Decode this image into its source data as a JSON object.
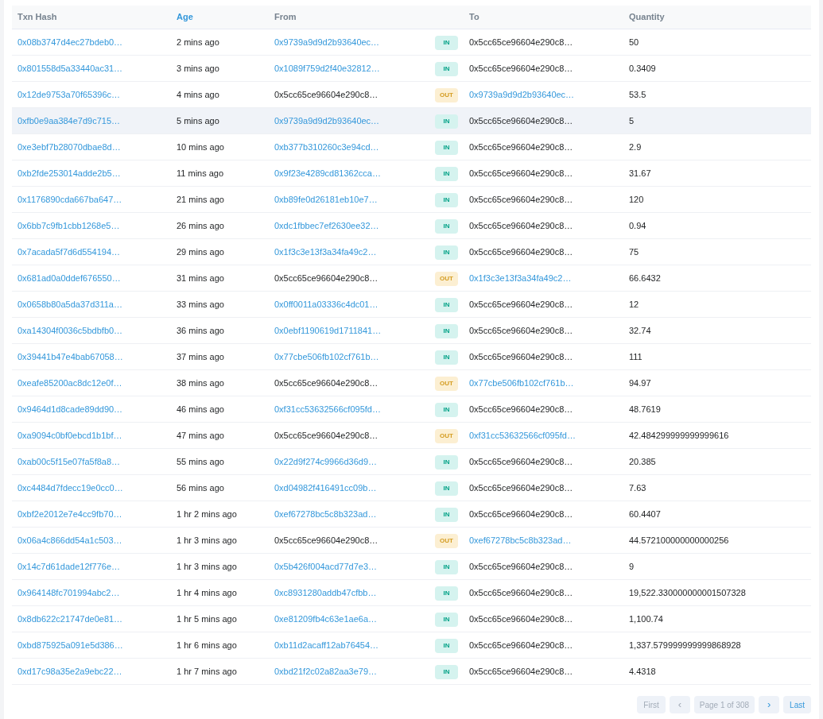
{
  "table": {
    "columns": [
      {
        "label": "Txn Hash",
        "selected": false
      },
      {
        "label": "Age",
        "selected": true
      },
      {
        "label": "From",
        "selected": false
      },
      {
        "label": "To",
        "selected": false
      },
      {
        "label": "Quantity",
        "selected": false
      }
    ],
    "rows": [
      {
        "hash": "0x08b3747d4ec27bdeb0…",
        "age": "2 mins ago",
        "from": "0x9739a9d9d2b93640ec…",
        "badge": "IN",
        "kind": "in",
        "to": "0x5cc65ce96604e290c8…",
        "quantity": "50",
        "highlighted": false
      },
      {
        "hash": "0x801558d5a33440ac31…",
        "age": "3 mins ago",
        "from": "0x1089f759d2f40e32812…",
        "badge": "IN",
        "kind": "in",
        "to": "0x5cc65ce96604e290c8…",
        "quantity": "0.3409",
        "highlighted": false
      },
      {
        "hash": "0x12de9753a70f65396c…",
        "age": "4 mins ago",
        "from": "0x5cc65ce96604e290c8…",
        "badge": "OUT",
        "kind": "out",
        "to": "0x9739a9d9d2b93640ec…",
        "quantity": "53.5",
        "highlighted": false
      },
      {
        "hash": "0xfb0e9aa384e7d9c715…",
        "age": "5 mins ago",
        "from": "0x9739a9d9d2b93640ec…",
        "badge": "IN",
        "kind": "in",
        "to": "0x5cc65ce96604e290c8…",
        "quantity": "5",
        "highlighted": true
      },
      {
        "hash": "0xe3ebf7b28070dbae8d…",
        "age": "10 mins ago",
        "from": "0xb377b310260c3e94cd…",
        "badge": "IN",
        "kind": "in",
        "to": "0x5cc65ce96604e290c8…",
        "quantity": "2.9",
        "highlighted": false
      },
      {
        "hash": "0xb2fde253014adde2b5…",
        "age": "11 mins ago",
        "from": "0x9f23e4289cd81362cca…",
        "badge": "IN",
        "kind": "in",
        "to": "0x5cc65ce96604e290c8…",
        "quantity": "31.67",
        "highlighted": false
      },
      {
        "hash": "0x1176890cda667ba647…",
        "age": "21 mins ago",
        "from": "0xb89fe0d26181eb10e7…",
        "badge": "IN",
        "kind": "in",
        "to": "0x5cc65ce96604e290c8…",
        "quantity": "120",
        "highlighted": false
      },
      {
        "hash": "0x6bb7c9fb1cbb1268e5…",
        "age": "26 mins ago",
        "from": "0xdc1fbbec7ef2630ee32…",
        "badge": "IN",
        "kind": "in",
        "to": "0x5cc65ce96604e290c8…",
        "quantity": "0.94",
        "highlighted": false
      },
      {
        "hash": "0x7acada5f7d6d554194…",
        "age": "29 mins ago",
        "from": "0x1f3c3e13f3a34fa49c2…",
        "badge": "IN",
        "kind": "in",
        "to": "0x5cc65ce96604e290c8…",
        "quantity": "75",
        "highlighted": false
      },
      {
        "hash": "0x681ad0a0ddef676550…",
        "age": "31 mins ago",
        "from": "0x5cc65ce96604e290c8…",
        "badge": "OUT",
        "kind": "out",
        "to": "0x1f3c3e13f3a34fa49c2…",
        "quantity": "66.6432",
        "highlighted": false
      },
      {
        "hash": "0x0658b80a5da37d311a…",
        "age": "33 mins ago",
        "from": "0x0ff0011a03336c4dc01…",
        "badge": "IN",
        "kind": "in",
        "to": "0x5cc65ce96604e290c8…",
        "quantity": "12",
        "highlighted": false
      },
      {
        "hash": "0xa14304f0036c5bdbfb0…",
        "age": "36 mins ago",
        "from": "0x0ebf1190619d1711841…",
        "badge": "IN",
        "kind": "in",
        "to": "0x5cc65ce96604e290c8…",
        "quantity": "32.74",
        "highlighted": false
      },
      {
        "hash": "0x39441b47e4bab67058…",
        "age": "37 mins ago",
        "from": "0x77cbe506fb102cf761b…",
        "badge": "IN",
        "kind": "in",
        "to": "0x5cc65ce96604e290c8…",
        "quantity": "111",
        "highlighted": false
      },
      {
        "hash": "0xeafe85200ac8dc12e0f…",
        "age": "38 mins ago",
        "from": "0x5cc65ce96604e290c8…",
        "badge": "OUT",
        "kind": "out",
        "to": "0x77cbe506fb102cf761b…",
        "quantity": "94.97",
        "highlighted": false
      },
      {
        "hash": "0x9464d1d8cade89dd90…",
        "age": "46 mins ago",
        "from": "0xf31cc53632566cf095fd…",
        "badge": "IN",
        "kind": "in",
        "to": "0x5cc65ce96604e290c8…",
        "quantity": "48.7619",
        "highlighted": false
      },
      {
        "hash": "0xa9094c0bf0ebcd1b1bf…",
        "age": "47 mins ago",
        "from": "0x5cc65ce96604e290c8…",
        "badge": "OUT",
        "kind": "out",
        "to": "0xf31cc53632566cf095fd…",
        "quantity": "42.484299999999999616",
        "highlighted": false
      },
      {
        "hash": "0xab00c5f15e07fa5f8a8…",
        "age": "55 mins ago",
        "from": "0x22d9f274c9966d36d9…",
        "badge": "IN",
        "kind": "in",
        "to": "0x5cc65ce96604e290c8…",
        "quantity": "20.385",
        "highlighted": false
      },
      {
        "hash": "0xc4484d7fdecc19e0cc0…",
        "age": "56 mins ago",
        "from": "0xd04982f416491cc09b…",
        "badge": "IN",
        "kind": "in",
        "to": "0x5cc65ce96604e290c8…",
        "quantity": "7.63",
        "highlighted": false
      },
      {
        "hash": "0xbf2e2012e7e4cc9fb70…",
        "age": "1 hr 2 mins ago",
        "from": "0xef67278bc5c8b323ad…",
        "badge": "IN",
        "kind": "in",
        "to": "0x5cc65ce96604e290c8…",
        "quantity": "60.4407",
        "highlighted": false
      },
      {
        "hash": "0x06a4c866dd54a1c503…",
        "age": "1 hr 3 mins ago",
        "from": "0x5cc65ce96604e290c8…",
        "badge": "OUT",
        "kind": "out",
        "to": "0xef67278bc5c8b323ad…",
        "quantity": "44.572100000000000256",
        "highlighted": false
      },
      {
        "hash": "0x14c7d61dade12f776e…",
        "age": "1 hr 3 mins ago",
        "from": "0x5b426f004acd77d7e3…",
        "badge": "IN",
        "kind": "in",
        "to": "0x5cc65ce96604e290c8…",
        "quantity": "9",
        "highlighted": false
      },
      {
        "hash": "0x964148fc701994abc2…",
        "age": "1 hr 4 mins ago",
        "from": "0xc8931280addb47cfbb…",
        "badge": "IN",
        "kind": "in",
        "to": "0x5cc65ce96604e290c8…",
        "quantity": "19,522.330000000001507328",
        "highlighted": false
      },
      {
        "hash": "0x8db622c21747de0e81…",
        "age": "1 hr 5 mins ago",
        "from": "0xe81209fb4c63e1ae6a…",
        "badge": "IN",
        "kind": "in",
        "to": "0x5cc65ce96604e290c8…",
        "quantity": "1,100.74",
        "highlighted": false
      },
      {
        "hash": "0xbd875925a091e5d386…",
        "age": "1 hr 6 mins ago",
        "from": "0xb11d2acaff12ab76454…",
        "badge": "IN",
        "kind": "in",
        "to": "0x5cc65ce96604e290c8…",
        "quantity": "1,337.579999999999868928",
        "highlighted": false
      },
      {
        "hash": "0xd17c98a35e2a9ebc22…",
        "age": "1 hr 7 mins ago",
        "from": "0xbd21f2c02a82aa3e79…",
        "badge": "IN",
        "kind": "in",
        "to": "0x5cc65ce96604e290c8…",
        "quantity": "4.4318",
        "highlighted": false
      }
    ]
  },
  "pagination": {
    "first": {
      "label": "First",
      "disabled": true
    },
    "prev": {
      "label": "‹",
      "disabled": true
    },
    "page": "Page 1 of 308",
    "next": {
      "label": "›",
      "disabled": false
    },
    "last": {
      "label": "Last",
      "disabled": false
    }
  }
}
